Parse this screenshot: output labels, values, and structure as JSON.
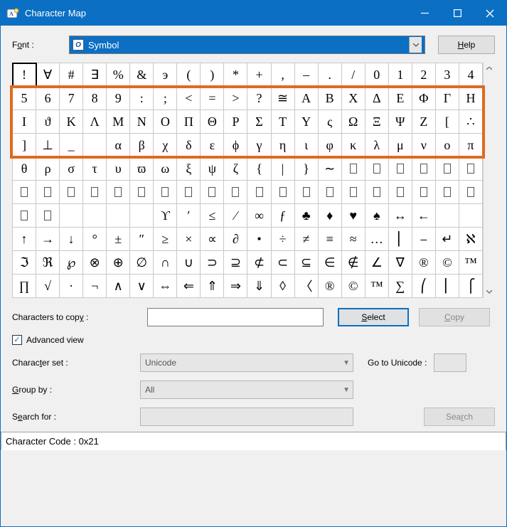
{
  "window": {
    "title": "Character Map"
  },
  "toolbar": {
    "font_label_pre": "F",
    "font_label_ul": "o",
    "font_label_post": "nt :",
    "font_name": "Symbol",
    "help_pre": "",
    "help_ul": "H",
    "help_post": "elp"
  },
  "grid": {
    "rows": [
      [
        "!",
        "∀",
        "#",
        "∃",
        "%",
        "&",
        "э",
        "(",
        ")",
        "*",
        "+",
        ",",
        "–",
        ".",
        "/",
        "0",
        "1",
        "2",
        "3",
        "4"
      ],
      [
        "5",
        "6",
        "7",
        "8",
        "9",
        ":",
        ";",
        "<",
        "=",
        ">",
        "?",
        "≅",
        "Α",
        "Β",
        "Χ",
        "Δ",
        "Ε",
        "Φ",
        "Γ",
        "Η"
      ],
      [
        "Ι",
        "ϑ",
        "Κ",
        "Λ",
        "Μ",
        "Ν",
        "Ο",
        "Π",
        "Θ",
        "Ρ",
        "Σ",
        "Τ",
        "Υ",
        "ς",
        "Ω",
        "Ξ",
        "Ψ",
        "Ζ",
        "[",
        "∴"
      ],
      [
        "]",
        "⊥",
        "_",
        "",
        "α",
        "β",
        "χ",
        "δ",
        "ε",
        "ϕ",
        "γ",
        "η",
        "ι",
        "φ",
        "κ",
        "λ",
        "μ",
        "ν",
        "ο",
        "π"
      ],
      [
        "θ",
        "ρ",
        "σ",
        "τ",
        "υ",
        "ϖ",
        "ω",
        "ξ",
        "ψ",
        "ζ",
        "{",
        "|",
        "}",
        "∼",
        "",
        "",
        "",
        "",
        "",
        ""
      ],
      [
        "",
        "",
        "",
        "",
        "",
        "",
        "",
        "",
        "",
        "",
        "",
        "",
        "",
        "",
        "",
        "",
        "",
        "",
        "",
        ""
      ],
      [
        "",
        "",
        "",
        "",
        "",
        "",
        "ϒ",
        "′",
        "≤",
        "⁄",
        "∞",
        "ƒ",
        "♣",
        "♦",
        "♥",
        "♠",
        "↔",
        "←"
      ],
      [
        "↑",
        "→",
        "↓",
        "°",
        "±",
        "″",
        "≥",
        "×",
        "∝",
        "∂",
        "•",
        "÷",
        "≠",
        "≡",
        "≈",
        "…",
        "⎜",
        "⎯",
        "↵",
        "ℵ"
      ],
      [
        "ℑ",
        "ℜ",
        "℘",
        "⊗",
        "⊕",
        "∅",
        "∩",
        "∪",
        "⊃",
        "⊇",
        "⊄",
        "⊂",
        "⊆",
        "∈",
        "∉",
        "∠",
        "∇",
        "®",
        "©",
        "™"
      ],
      [
        "∏",
        "√",
        "·",
        "¬",
        "∧",
        "∨",
        "⇔",
        "⇐",
        "⇑",
        "⇒",
        "⇓",
        "◊",
        "〈",
        "®",
        "©",
        "™",
        "∑",
        "⎛",
        "⎜",
        "⎧"
      ]
    ],
    "row6_fill_start": 0,
    "row6_fill_count": 20,
    "row5_empty_from": 14,
    "row7_empty_prefix": 2
  },
  "highlight": {
    "row_start": 1,
    "row_end": 3
  },
  "copy_section": {
    "label_pre": "Characters to cop",
    "label_ul": "y",
    "label_post": " :",
    "value": "",
    "select_pre": "",
    "select_ul": "S",
    "select_post": "elect",
    "copy_pre": "",
    "copy_ul": "C",
    "copy_post": "opy"
  },
  "advanced": {
    "checked": true,
    "label_pre": "Ad",
    "label_ul": "v",
    "label_post": "anced view"
  },
  "charset": {
    "label_pre": "Charac",
    "label_ul": "t",
    "label_post": "er set :",
    "value": "Unicode",
    "goto_pre": "Go to ",
    "goto_ul": "U",
    "goto_post": "nicode :",
    "goto_value": ""
  },
  "groupby": {
    "label_pre": "",
    "label_ul": "G",
    "label_post": "roup by :",
    "value": "All"
  },
  "search": {
    "label_pre": "S",
    "label_ul": "e",
    "label_post": "arch for :",
    "value": "",
    "btn_pre": "Sea",
    "btn_ul": "r",
    "btn_post": "ch"
  },
  "status": {
    "text": "Character Code : 0x21"
  }
}
